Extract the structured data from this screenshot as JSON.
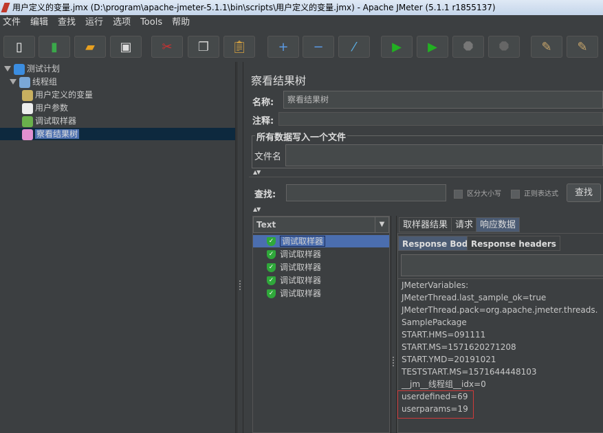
{
  "window": {
    "title": "用户定义的变量.jmx (D:\\program\\apache-jmeter-5.1.1\\bin\\scripts\\用户定义的变量.jmx) - Apache JMeter (5.1.1 r1855137)"
  },
  "menu": [
    "文件",
    "编辑",
    "查找",
    "运行",
    "选项",
    "Tools",
    "帮助"
  ],
  "toolbar": [
    {
      "name": "new",
      "icon": "new-file-icon",
      "glyph": "▯",
      "color": "#f5f5f5",
      "title": "New"
    },
    {
      "name": "templates",
      "icon": "templates-icon",
      "glyph": "▮",
      "color": "#3aa84a",
      "title": "Templates"
    },
    {
      "name": "open",
      "icon": "folder-open-icon",
      "glyph": "▰",
      "color": "#e8a020",
      "title": "Open"
    },
    {
      "name": "save",
      "icon": "save-icon",
      "glyph": "▣",
      "color": "#ddd",
      "title": "Save"
    },
    {
      "name": "cut",
      "icon": "scissors-icon",
      "glyph": "✂",
      "color": "#d03030",
      "title": "Cut"
    },
    {
      "name": "copy",
      "icon": "copy-icon",
      "glyph": "❐",
      "color": "#ccc",
      "title": "Copy"
    },
    {
      "name": "paste",
      "icon": "clipboard-icon",
      "glyph": "📋︎",
      "color": "#d9a441",
      "title": "Paste"
    },
    {
      "name": "expand",
      "icon": "plus-icon",
      "glyph": "+",
      "color": "#5b9be6",
      "title": "Expand"
    },
    {
      "name": "collapse",
      "icon": "minus-icon",
      "glyph": "−",
      "color": "#5b9be6",
      "title": "Collapse"
    },
    {
      "name": "toggle",
      "icon": "toggle-wand-icon",
      "glyph": "⁄",
      "color": "#5bb0e6",
      "title": "Toggle"
    },
    {
      "name": "start",
      "icon": "play-icon",
      "glyph": "▶",
      "color": "#22b022",
      "title": "Start"
    },
    {
      "name": "start-no-pause",
      "icon": "play-no-timers-icon",
      "glyph": "▶",
      "color": "#22b022",
      "title": "Start no pauses"
    },
    {
      "name": "stop",
      "icon": "stop-octagon-icon",
      "glyph": "⯃",
      "color": "#777",
      "title": "Stop"
    },
    {
      "name": "shutdown",
      "icon": "shutdown-octagon-icon",
      "glyph": "⯃",
      "color": "#666",
      "title": "Shutdown"
    },
    {
      "name": "clear",
      "icon": "broom-icon",
      "glyph": "✎",
      "color": "#c9a66b",
      "title": "Clear"
    },
    {
      "name": "clear-all",
      "icon": "broom-all-icon",
      "glyph": "✎",
      "color": "#c9a66b",
      "title": "Clear All"
    }
  ],
  "tree": [
    {
      "label": "测试计划",
      "icon": "test-plan-flask-icon",
      "color": "#3b8de0"
    },
    {
      "label": "线程组",
      "icon": "thread-group-gear-icon",
      "color": "#7aa7d6"
    },
    {
      "label": "用户定义的变量",
      "icon": "wrench-icon",
      "color": "#c8b060"
    },
    {
      "label": "用户参数",
      "icon": "user-params-icon",
      "color": "#eee"
    },
    {
      "label": "调试取样器",
      "icon": "pipette-icon",
      "color": "#6ab04c"
    },
    {
      "label": "察看结果树",
      "icon": "chart-icon",
      "color": "#e08fd0"
    }
  ],
  "panel": {
    "title": "察看结果树",
    "name_label": "名称:",
    "name_value": "察看结果树",
    "comment_label": "注释:",
    "group_title": "所有数据写入一个文件",
    "filename_label": "文件名",
    "search_label": "查找:",
    "case_sensitive": "区分大小写",
    "regex": "正则表达式",
    "search_button": "查找",
    "renderer": "Text",
    "samples": [
      "调试取样器",
      "调试取样器",
      "调试取样器",
      "调试取样器",
      "调试取样器"
    ],
    "tabs": [
      "取样器结果",
      "请求",
      "响应数据"
    ],
    "selected_tab": "响应数据",
    "subtabs": [
      "Response Body",
      "Response headers"
    ],
    "response_lines": [
      "JMeterVariables:",
      "JMeterThread.last_sample_ok=true",
      "JMeterThread.pack=org.apache.jmeter.threads.SamplePackage",
      "START.HMS=091111",
      "START.MS=1571620271208",
      "START.YMD=20191021",
      "TESTSTART.MS=1571644448103",
      "__jm__线程组__idx=0",
      "userdefined=69",
      "userparams=19"
    ],
    "highlight_color": "#d03a3a"
  }
}
